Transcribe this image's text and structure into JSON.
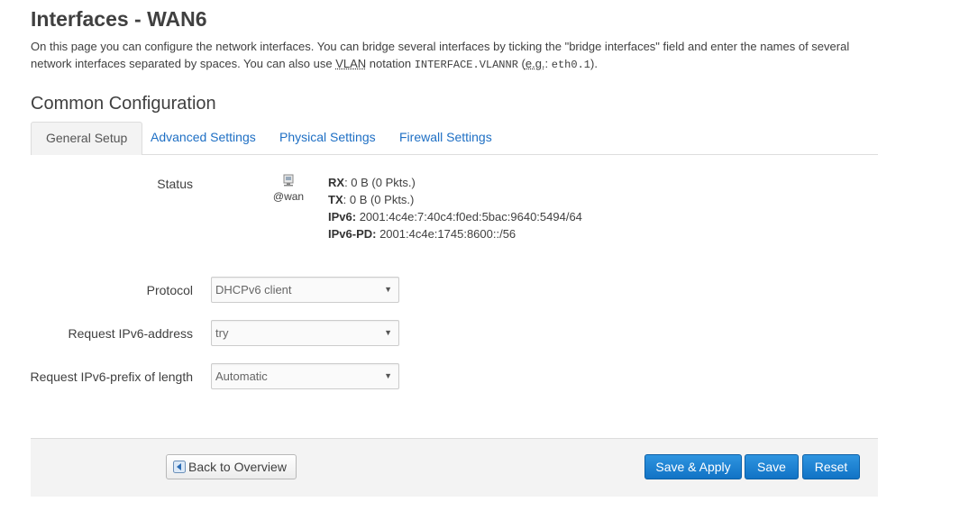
{
  "header": {
    "title": "Interfaces - WAN6",
    "description_part1": "On this page you can configure the network interfaces. You can bridge several interfaces by ticking the \"bridge interfaces\" field and enter the names of several network interfaces separated by spaces. You can also use ",
    "vlan_abbr": "VLAN",
    "description_part2": " notation ",
    "notation_code": "INTERFACE.VLANNR",
    "description_part3": " (",
    "eg_abbr": "e.g.",
    "description_part4": ": ",
    "example_code": "eth0.1",
    "description_part5": ")."
  },
  "section": {
    "title": "Common Configuration"
  },
  "tabs": [
    {
      "label": "General Setup",
      "active": true
    },
    {
      "label": "Advanced Settings",
      "active": false
    },
    {
      "label": "Physical Settings",
      "active": false
    },
    {
      "label": "Firewall Settings",
      "active": false
    }
  ],
  "status": {
    "label": "Status",
    "interface_icon": "network-interface-icon",
    "interface_name": "@wan",
    "rx_label": "RX",
    "rx_value": ": 0 B (0 Pkts.)",
    "tx_label": "TX",
    "tx_value": ": 0 B (0 Pkts.)",
    "ipv6_label": "IPv6:",
    "ipv6_value": " 2001:4c4e:7:40c4:f0ed:5bac:9640:5494/64",
    "ipv6pd_label": "IPv6-PD:",
    "ipv6pd_value": " 2001:4c4e:1745:8600::/56"
  },
  "fields": {
    "protocol": {
      "label": "Protocol",
      "value": "DHCPv6 client"
    },
    "request_address": {
      "label": "Request IPv6-address",
      "value": "try"
    },
    "request_prefix": {
      "label": "Request IPv6-prefix of length",
      "value": "Automatic"
    }
  },
  "footer": {
    "back_label": "Back to Overview",
    "back_icon": "back-arrow-icon",
    "save_apply_label": "Save & Apply",
    "save_label": "Save",
    "reset_label": "Reset"
  },
  "colors": {
    "link": "#1e6fc4",
    "primary_button": "#1a7fd4",
    "footer_bg": "#f3f3f3"
  }
}
